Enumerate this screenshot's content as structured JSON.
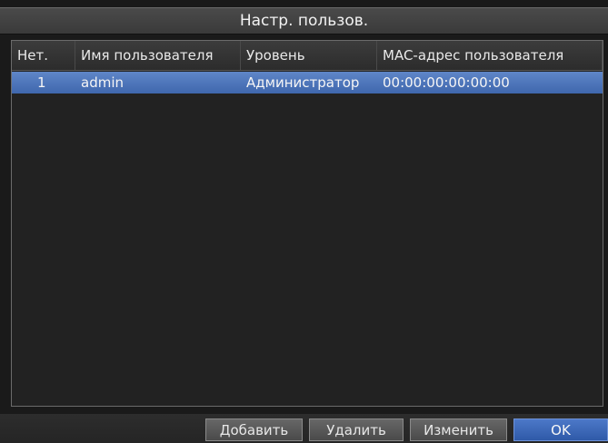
{
  "window": {
    "title": "Настр. пользов."
  },
  "table": {
    "columns": [
      "Нет.",
      "Имя пользователя",
      "Уровень",
      "MAC-адрес пользователя"
    ],
    "rows": [
      [
        "1",
        "admin",
        "Администратор",
        "00:00:00:00:00:00"
      ]
    ]
  },
  "buttons": {
    "add": "Добавить",
    "delete": "Удалить",
    "edit": "Изменить",
    "ok": "OK"
  },
  "colors": {
    "selected_row": "#4f77bb",
    "ok_button": "#3d68b8",
    "background": "#1c1c1c"
  }
}
